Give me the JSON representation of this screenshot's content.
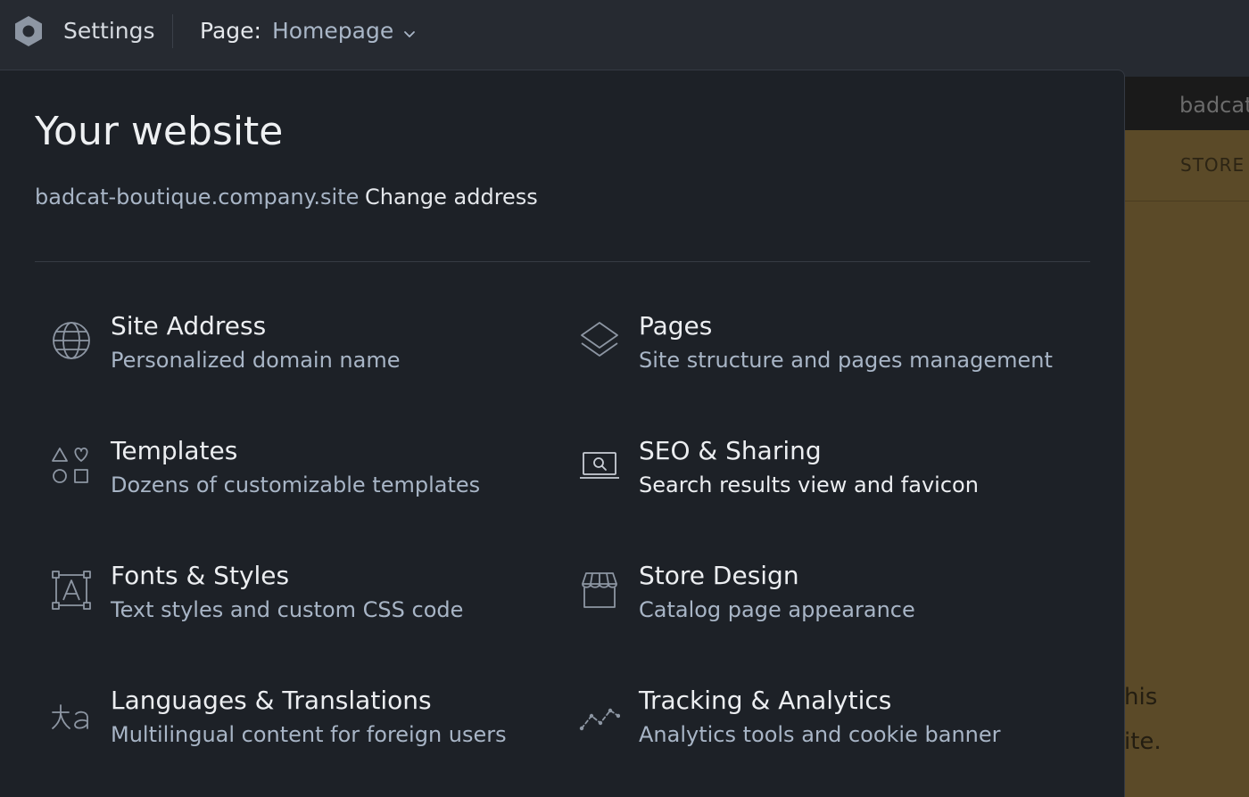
{
  "topbar": {
    "settings_label": "Settings",
    "page_label": "Page:",
    "page_value": "Homepage"
  },
  "panel": {
    "title": "Your website",
    "site_url": "badcat-boutique.company.site",
    "change_address": "Change address",
    "items": [
      {
        "title": "Site Address",
        "desc": "Personalized domain name",
        "icon": "globe-icon"
      },
      {
        "title": "Pages",
        "desc": "Site structure and pages management",
        "icon": "layers-icon"
      },
      {
        "title": "Templates",
        "desc": "Dozens of customizable templates",
        "icon": "shapes-icon"
      },
      {
        "title": "SEO & Sharing",
        "desc": "Search results view and favicon",
        "icon": "laptop-search-icon"
      },
      {
        "title": "Fonts & Styles",
        "desc": "Text styles and custom CSS code",
        "icon": "text-frame-icon"
      },
      {
        "title": "Store Design",
        "desc": "Catalog page appearance",
        "icon": "storefront-icon"
      },
      {
        "title": "Languages & Translations",
        "desc": "Multilingual content for foreign users",
        "icon": "translate-icon"
      },
      {
        "title": "Tracking & Analytics",
        "desc": "Analytics tools and cookie banner",
        "icon": "analytics-line-icon"
      }
    ]
  },
  "preview": {
    "site_name": "badcat",
    "nav_store": "STORE",
    "text_line_1": "his",
    "text_line_2": "ite."
  },
  "colors": {
    "panel_bg": "#1d2127",
    "topbar_bg": "#262a31",
    "muted_text": "#a8b5c6",
    "preview_bg": "#5b4a28"
  }
}
